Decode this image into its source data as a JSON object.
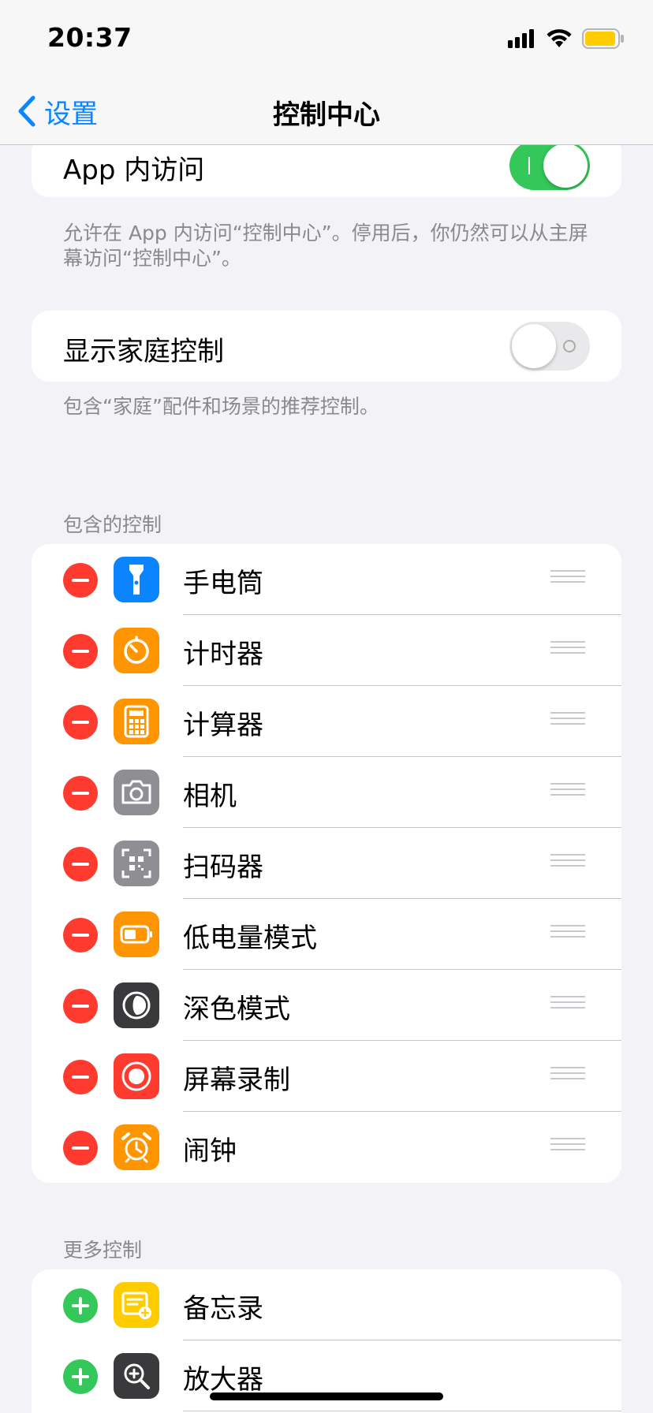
{
  "status": {
    "time": "20:37"
  },
  "nav": {
    "back_label": "设置",
    "title": "控制中心"
  },
  "access": {
    "label": "App 内访问",
    "enabled": true,
    "footnote": "允许在 App 内访问“控制中心”。停用后，你仍然可以从主屏幕访问“控制中心”。"
  },
  "home_controls": {
    "label": "显示家庭控制",
    "enabled": false,
    "footnote": "包含“家庭”配件和场景的推荐控制。"
  },
  "included": {
    "header": "包含的控制",
    "items": [
      {
        "label": "手电筒",
        "icon": "flashlight-icon",
        "color": "#0a84ff"
      },
      {
        "label": "计时器",
        "icon": "timer-icon",
        "color": "#ff9500"
      },
      {
        "label": "计算器",
        "icon": "calculator-icon",
        "color": "#ff9500"
      },
      {
        "label": "相机",
        "icon": "camera-icon",
        "color": "#8e8e93"
      },
      {
        "label": "扫码器",
        "icon": "qr-code-icon",
        "color": "#8e8e93"
      },
      {
        "label": "低电量模式",
        "icon": "battery-icon",
        "color": "#ff9500"
      },
      {
        "label": "深色模式",
        "icon": "dark-mode-icon",
        "color": "#3a3a3c"
      },
      {
        "label": "屏幕录制",
        "icon": "screen-record-icon",
        "color": "#ff3b30"
      },
      {
        "label": "闹钟",
        "icon": "alarm-icon",
        "color": "#ff9500"
      }
    ]
  },
  "more": {
    "header": "更多控制",
    "items": [
      {
        "label": "备忘录",
        "icon": "notes-icon",
        "color": "#ffcc00"
      },
      {
        "label": "放大器",
        "icon": "magnifier-icon",
        "color": "#3a3a3c"
      }
    ]
  }
}
